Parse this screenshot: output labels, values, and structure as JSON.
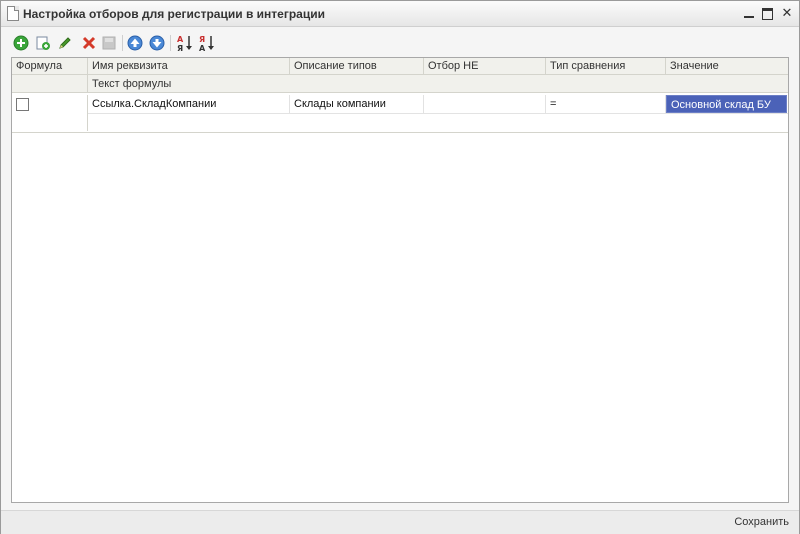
{
  "window": {
    "title": "Настройка отборов для регистрации в интеграции",
    "controls": {
      "minimize": "minimize",
      "maximize": "maximize",
      "close": "✕"
    }
  },
  "toolbar": {
    "buttons": [
      {
        "name": "add-icon",
        "color": "#3aa63a"
      },
      {
        "name": "copy-icon",
        "color": "#6a9fd8"
      },
      {
        "name": "edit-icon",
        "color": "#4a9a2c"
      },
      {
        "name": "delete-icon",
        "color": "#d43a2a"
      },
      {
        "name": "disabled-icon",
        "color": "#c8c8c8"
      },
      {
        "name": "move-up-icon",
        "color": "#3a78c8"
      },
      {
        "name": "move-down-icon",
        "color": "#3a78c8"
      },
      {
        "name": "sort-ascending-icon",
        "color": "#c83030"
      },
      {
        "name": "sort-descending-icon",
        "color": "#c83030"
      }
    ]
  },
  "table": {
    "columns": [
      "Формула",
      "Имя реквизита",
      "Описание типов",
      "Отбор НЕ",
      "Тип сравнения",
      "Значение"
    ],
    "subheader": "Текст формулы",
    "rows": [
      {
        "formula_checked": false,
        "attribute_name": "Ссылка.СкладКомпании",
        "type_description": "Склады компании",
        "filter_not": "",
        "comparison_type": "=",
        "value": "Основной склад БУ"
      }
    ],
    "selection_color": "#4b62b8"
  },
  "footer": {
    "save_label": "Сохранить"
  }
}
